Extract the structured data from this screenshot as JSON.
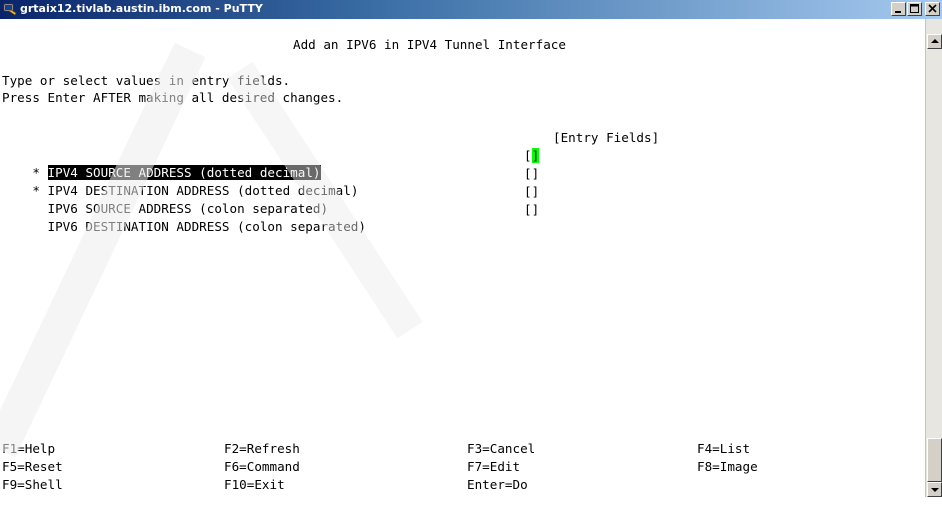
{
  "window": {
    "title": "grtaix12.tivlab.austin.ibm.com - PuTTY",
    "buttons": {
      "minimize": "_",
      "maximize": "□",
      "close": "X"
    }
  },
  "screen": {
    "header": "Add an IPV6 in IPV4 Tunnel Interface",
    "instructions": [
      "Type or select values in entry fields.",
      "Press Enter AFTER making all desired changes."
    ],
    "column_header": "[Entry Fields]",
    "fields": [
      {
        "marker": "*",
        "label": "IPV4 SOURCE ADDRESS (dotted decimal)",
        "value": "",
        "selected": true
      },
      {
        "marker": "*",
        "label": "IPV4 DESTINATION ADDRESS (dotted decimal)",
        "value": "",
        "selected": false
      },
      {
        "marker": "",
        "label": "IPV6 SOURCE ADDRESS (colon separated)",
        "value": "",
        "selected": false
      },
      {
        "marker": "",
        "label": "IPV6 DESTINATION ADDRESS (colon separated)",
        "value": "",
        "selected": false
      }
    ],
    "function_keys": [
      [
        "F1=Help",
        "F2=Refresh",
        "F3=Cancel",
        "F4=List"
      ],
      [
        "F5=Reset",
        "F6=Command",
        "F7=Edit",
        "F8=Image"
      ],
      [
        "F9=Shell",
        "F10=Exit",
        "Enter=Do",
        ""
      ]
    ]
  },
  "colors": {
    "cursor": "#00ff00",
    "selection_bg": "#000000",
    "watermark": "#ececec"
  },
  "icons": {
    "app": "putty-icon",
    "scroll_up": "arrow-up-icon",
    "scroll_down": "arrow-down-icon"
  }
}
